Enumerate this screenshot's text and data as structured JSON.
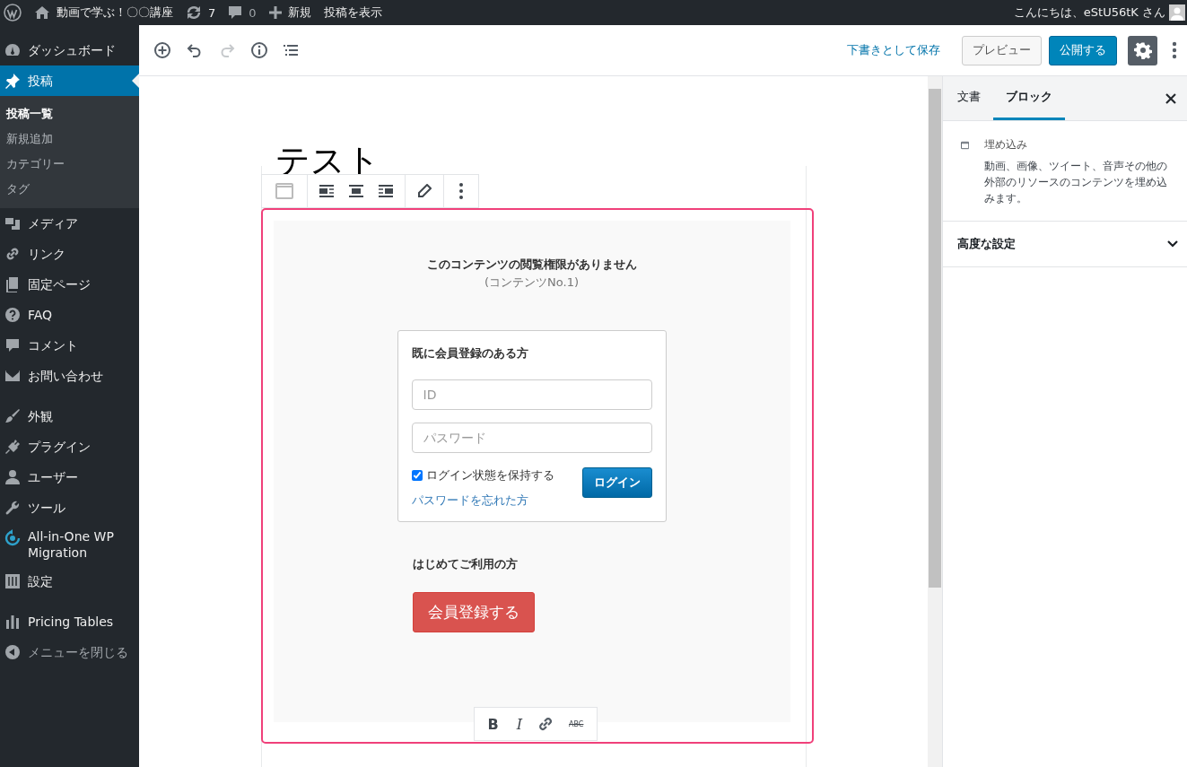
{
  "admin_bar": {
    "site_name": "動画で学ぶ！〇〇講座",
    "updates": "7",
    "comments": "0",
    "new_label": "新規",
    "view_post": "投稿を表示",
    "greeting": "こんにちは、eStU56tK さん"
  },
  "sidebar": {
    "groups": [
      [
        {
          "label": "ダッシュボード",
          "selected": false
        },
        {
          "label": "投稿",
          "selected": true,
          "submenu": [
            {
              "label": "投稿一覧",
              "selected": true
            },
            {
              "label": "新規追加",
              "selected": false
            },
            {
              "label": "カテゴリー",
              "selected": false
            },
            {
              "label": "タグ",
              "selected": false
            }
          ]
        },
        {
          "label": "メディア",
          "selected": false
        },
        {
          "label": "リンク",
          "selected": false
        },
        {
          "label": "固定ページ",
          "selected": false
        },
        {
          "label": "FAQ",
          "selected": false
        },
        {
          "label": "コメント",
          "selected": false
        },
        {
          "label": "お問い合わせ",
          "selected": false
        }
      ],
      [
        {
          "label": "外観",
          "selected": false
        },
        {
          "label": "プラグイン",
          "selected": false
        },
        {
          "label": "ユーザー",
          "selected": false
        },
        {
          "label": "ツール",
          "selected": false
        },
        {
          "label": "All-in-One WP Migration",
          "selected": false
        },
        {
          "label": "設定",
          "selected": false
        }
      ],
      [
        {
          "label": "Pricing Tables",
          "selected": false
        }
      ]
    ],
    "collapse_label": "メニューを閉じる"
  },
  "editor_header": {
    "redo_disabled": true,
    "save_draft": "下書きとして保存",
    "preview": "プレビュー",
    "publish": "公開する",
    "settings_active": true
  },
  "post": {
    "title": "テスト",
    "block": {
      "selected": true,
      "heading": "このコンテンツの閲覧権限がありません",
      "content_no": "(コンテンツNo.1)",
      "login": {
        "title": "既に会員登録のある方",
        "id_placeholder": "ID",
        "password_placeholder": "パスワード",
        "remember_label": "ログイン状態を保持する",
        "remember_checked": true,
        "login_button": "ログイン",
        "forgot_link": "パスワードを忘れた方"
      },
      "new_user": {
        "title": "はじめてご利用の方",
        "button": "会員登録する"
      }
    },
    "format_toolbar": [
      {
        "kind": "bold",
        "label": "B"
      },
      {
        "kind": "italic",
        "label": "I"
      },
      {
        "kind": "link"
      },
      {
        "kind": "strike",
        "label": "ABC"
      }
    ]
  },
  "settings_panel": {
    "tabs": [
      {
        "label": "文書",
        "selected": false
      },
      {
        "label": "ブロック",
        "selected": true
      }
    ],
    "block_card": {
      "title": "埋め込み",
      "description": "動画、画像、ツイート、音声その他の外部のリソースのコンテンツを埋め込みます。"
    },
    "panels": [
      {
        "title": "高度な設定",
        "expanded": false
      }
    ]
  }
}
